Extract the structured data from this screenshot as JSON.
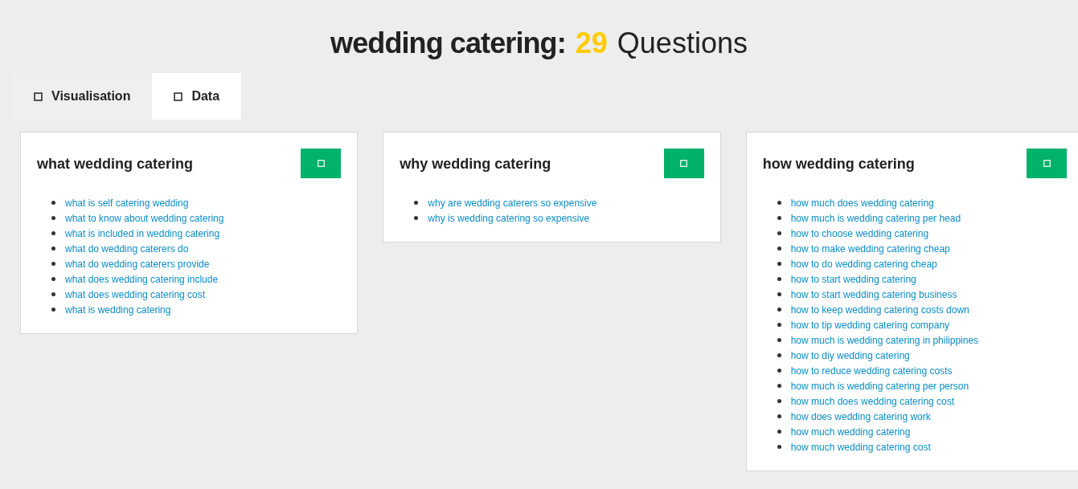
{
  "title": {
    "keyword": "wedding catering:",
    "count": "29",
    "label": "Questions"
  },
  "tabs": [
    {
      "label": "Visualisation",
      "selected": false
    },
    {
      "label": "Data",
      "selected": true
    }
  ],
  "cards": [
    {
      "heading": "what wedding catering",
      "questions": [
        "what is self catering wedding",
        "what to know about wedding catering",
        "what is included in wedding catering",
        "what do wedding caterers do",
        "what do wedding caterers provide",
        "what does wedding catering include",
        "what does wedding catering cost",
        "what is wedding catering"
      ]
    },
    {
      "heading": "why wedding catering",
      "questions": [
        "why are wedding caterers so expensive",
        "why is wedding catering so expensive"
      ]
    },
    {
      "heading": "how wedding catering",
      "questions": [
        "how much does wedding catering",
        "how much is wedding catering per head",
        "how to choose wedding catering",
        "how to make wedding catering cheap",
        "how to do wedding catering cheap",
        "how to start wedding catering",
        "how to start wedding catering business",
        "how to keep wedding catering costs down",
        "how to tip wedding catering company",
        "how much is wedding catering in philippines",
        "how to diy wedding catering",
        "how to reduce wedding catering costs",
        "how much is wedding catering per person",
        "how much does wedding catering cost",
        "how does wedding catering work",
        "how much wedding catering",
        "how much wedding catering cost"
      ]
    }
  ]
}
